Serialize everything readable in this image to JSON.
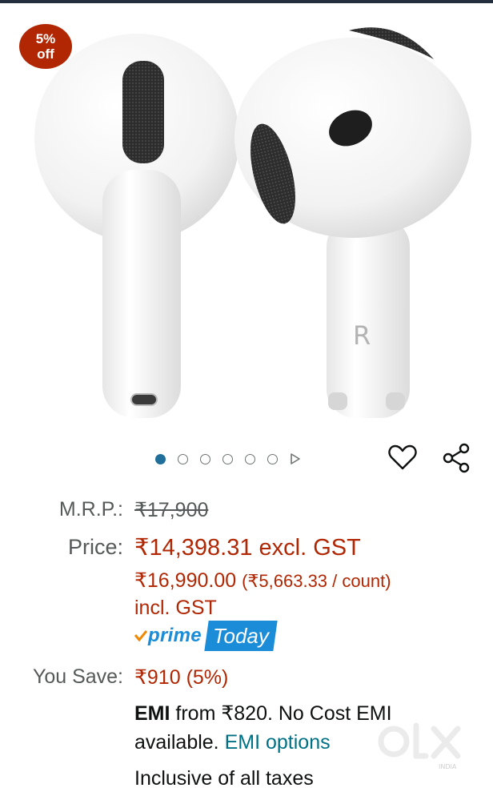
{
  "badge": {
    "line1": "5%",
    "line2": "off"
  },
  "product": {
    "image_icon": "earbuds-product-image"
  },
  "carousel": {
    "dot_count": 6,
    "active_index": 0
  },
  "icons": {
    "wishlist": "heart-icon",
    "share": "share-icon",
    "next": "play-icon"
  },
  "pricing": {
    "mrp_label": "M.R.P.:",
    "mrp_value": "₹17,900",
    "price_label": "Price:",
    "price_value": "₹14,398.31 excl. GST",
    "price_incl_main": "₹16,990.00",
    "price_incl_unit": "(₹5,663.33 / count)",
    "incl_gst": "incl. GST",
    "prime_word": "prime",
    "prime_today": "Today",
    "save_label": "You Save:",
    "save_value": "₹910 (5%)",
    "emi_bold": "EMI",
    "emi_text": "from ₹820. No Cost EMI",
    "emi_available": "available.",
    "emi_link": "EMI options",
    "taxes": "Inclusive of all taxes"
  },
  "watermark": {
    "icon": "olx-watermark",
    "text": "INDIA"
  },
  "colors": {
    "price_red": "#b12704",
    "link_teal": "#007185",
    "prime_blue": "#1a8cd8",
    "dot_active": "#1f6f9a"
  }
}
